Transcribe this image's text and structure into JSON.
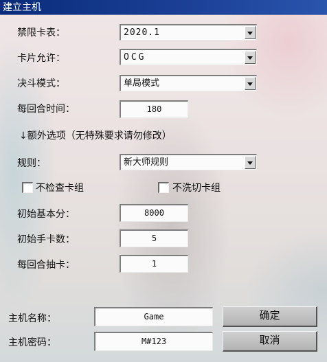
{
  "window": {
    "title": "建立主机"
  },
  "rules": {
    "banlist": {
      "label": "禁限卡表：",
      "value": "2020.1"
    },
    "card_allow": {
      "label": "卡片允许：",
      "value": "OCG"
    },
    "duel_mode": {
      "label": "决斗模式：",
      "value": "单局模式"
    },
    "turn_time": {
      "label": "每回合时间：",
      "value": "180"
    }
  },
  "extra": {
    "header": "↓额外选项（无特殊要求请勿修改）",
    "rule": {
      "label": "规则：",
      "value": "新大师规则"
    },
    "no_check_deck": {
      "label": "不检查卡组",
      "checked": false
    },
    "no_shuffle_deck": {
      "label": "不洗切卡组",
      "checked": false
    },
    "start_lp": {
      "label": "初始基本分：",
      "value": "8000"
    },
    "start_hand": {
      "label": "初始手卡数：",
      "value": "5"
    },
    "draw_count": {
      "label": "每回合抽卡：",
      "value": "1"
    }
  },
  "host": {
    "name": {
      "label": "主机名称：",
      "value": "Game"
    },
    "password": {
      "label": "主机密码：",
      "value": "M#123"
    },
    "ok_label": "确定",
    "cancel_label": "取消"
  }
}
